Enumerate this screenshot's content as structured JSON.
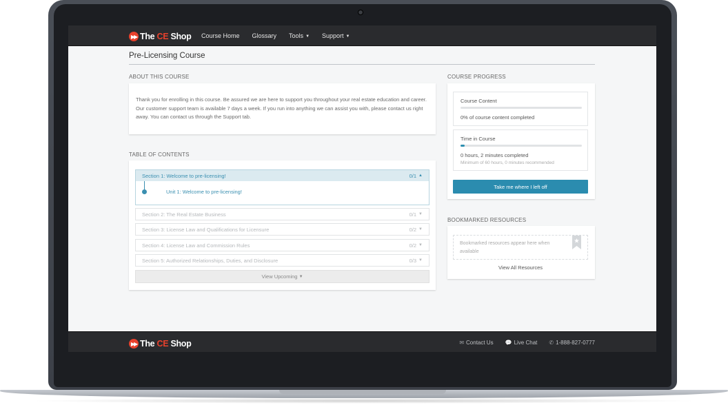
{
  "header": {
    "logo": {
      "pre": "The ",
      "ce": "CE",
      "post": " Shop"
    },
    "nav": [
      {
        "label": "Course Home",
        "dropdown": false
      },
      {
        "label": "Glossary",
        "dropdown": false
      },
      {
        "label": "Tools",
        "dropdown": true
      },
      {
        "label": "Support",
        "dropdown": true
      }
    ]
  },
  "page": {
    "title": "Pre-Licensing Course"
  },
  "about": {
    "label": "ABOUT THIS COURSE",
    "text": "Thank you for enrolling in this course. Be assured we are here to support you throughout your real estate education and career. Our customer support team is available 7 days a week. If you run into anything we can assist you with, please contact us right away. You can contact us through the Support tab."
  },
  "toc": {
    "label": "TABLE OF CONTENTS",
    "active_section": {
      "title": "Section 1: Welcome to pre-licensing!",
      "count": "0/1",
      "chevron": "up",
      "units": [
        {
          "label": "Unit 1: Welcome to pre-licensing!"
        }
      ]
    },
    "sections": [
      {
        "title": "Section 2: The Real Estate Business",
        "count": "0/1"
      },
      {
        "title": "Section 3: License Law and Qualifications for Licensure",
        "count": "0/2"
      },
      {
        "title": "Section 4: License Law and Commission Rules",
        "count": "0/2"
      },
      {
        "title": "Section 5: Authorized Relationships, Duties, and Disclosure",
        "count": "0/3"
      }
    ],
    "view_upcoming": "View Upcoming"
  },
  "progress": {
    "label": "COURSE PROGRESS",
    "content": {
      "title": "Course Content",
      "value": 0,
      "text": "0% of course content completed"
    },
    "time": {
      "title": "Time in Course",
      "value": 0.033,
      "text": "0 hours, 2 minutes completed",
      "sub": "Minimum of 60 hours, 0 minutes recommended"
    },
    "resume_button": "Take me where I left off"
  },
  "bookmarks": {
    "label": "BOOKMARKED RESOURCES",
    "empty_text": "Bookmarked resources appear here when available",
    "view_all": "View All Resources"
  },
  "footer": {
    "links": [
      {
        "icon": "envelope-icon",
        "label": "Contact Us"
      },
      {
        "icon": "chat-icon",
        "label": "Live Chat"
      },
      {
        "icon": "phone-icon",
        "label": "1-888-827-0777"
      }
    ]
  },
  "colors": {
    "accent": "#2b8caf",
    "brand": "#e8412c",
    "nav_bg": "#2a2b2e"
  }
}
